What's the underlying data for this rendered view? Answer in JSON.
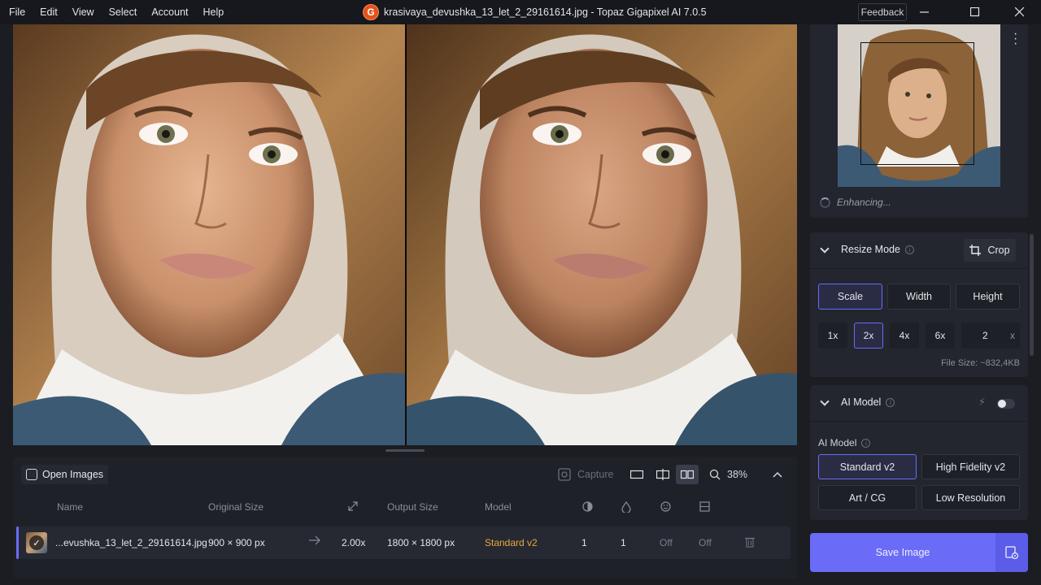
{
  "menu": [
    "File",
    "Edit",
    "View",
    "Select",
    "Account",
    "Help"
  ],
  "window": {
    "title": "krasivaya_devushka_13_let_2_29161614.jpg - Topaz Gigapixel AI 7.0.5",
    "logo_letter": "G",
    "feedback_label": "Feedback"
  },
  "preview": {
    "status": "Enhancing..."
  },
  "resize_mode": {
    "title": "Resize Mode",
    "crop_label": "Crop",
    "modes": [
      "Scale",
      "Width",
      "Height"
    ],
    "active_mode": "Scale",
    "scales": [
      "1x",
      "2x",
      "4x",
      "6x"
    ],
    "active_scale": "2x",
    "custom_value": "2",
    "custom_unit": "x",
    "file_size": "File Size: ~832,4KB"
  },
  "ai_model": {
    "title": "AI Model",
    "sublabel": "AI Model",
    "models": [
      "Standard v2",
      "High Fidelity v2",
      "Art / CG",
      "Low Resolution"
    ],
    "active_model": "Standard v2"
  },
  "save": {
    "label": "Save Image"
  },
  "bottom": {
    "open_label": "Open Images",
    "capture_label": "Capture",
    "zoom": "38%",
    "headers": {
      "name": "Name",
      "original": "Original Size",
      "output": "Output Size",
      "model": "Model"
    },
    "row": {
      "name": "...evushka_13_let_2_29161614.jpg",
      "original": "900 × 900 px",
      "scale": "2.00x",
      "output": "1800 × 1800 px",
      "model": "Standard v2",
      "v1": "1",
      "v2": "1",
      "v3": "Off",
      "v4": "Off"
    }
  },
  "colors": {
    "accent": "#6a6cf7",
    "model_text": "#e8a93a"
  }
}
